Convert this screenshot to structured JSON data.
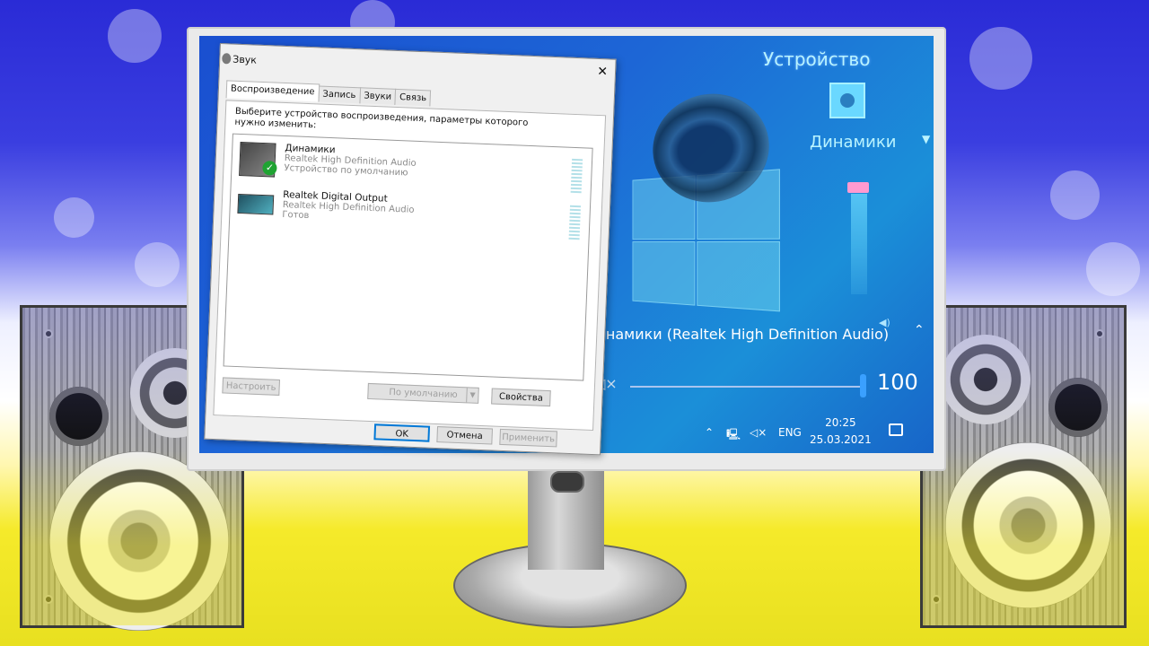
{
  "window": {
    "title": "Звук",
    "tabs": [
      "Воспроизведение",
      "Запись",
      "Звуки",
      "Связь"
    ],
    "instruction": "Выберите устройство воспроизведения, параметры которого нужно изменить:",
    "devices": [
      {
        "name": "Динамики",
        "driver": "Realtek High Definition Audio",
        "status": "Устройство по умолчанию",
        "default": true
      },
      {
        "name": "Realtek Digital Output",
        "driver": "Realtek High Definition Audio",
        "status": "Готов",
        "default": false
      }
    ],
    "buttons": {
      "configure": "Настроить",
      "set_default": "По умолчанию",
      "properties": "Свойства",
      "ok": "OK",
      "cancel": "Отмена",
      "apply": "Применить"
    }
  },
  "volume_mixer": {
    "title": "Устройство",
    "device": "Динамики",
    "output_label": "Динамики (Realtek High Definition Audio)",
    "volume": 100
  },
  "taskbar": {
    "language": "ENG",
    "time": "20:25",
    "date": "25.03.2021"
  },
  "colors": {
    "accent": "#0078d7",
    "check": "#1fa332",
    "desktop": "#1d66d6"
  }
}
